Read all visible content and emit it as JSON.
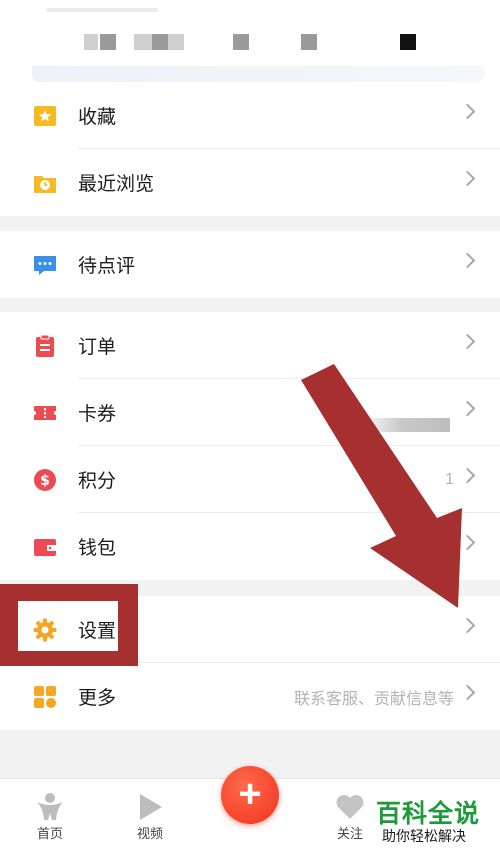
{
  "menu": {
    "favorites": {
      "label": "收藏",
      "icon": "star-folder-icon"
    },
    "recent": {
      "label": "最近浏览",
      "icon": "clock-folder-icon"
    },
    "pending_review": {
      "label": "待点评",
      "icon": "chat-bubble-icon"
    },
    "orders": {
      "label": "订单",
      "icon": "clipboard-icon"
    },
    "coupons": {
      "label": "卡券",
      "icon": "ticket-icon"
    },
    "points": {
      "label": "积分",
      "value": "1",
      "icon": "dollar-icon"
    },
    "wallet": {
      "label": "钱包",
      "icon": "wallet-icon"
    },
    "settings": {
      "label": "设置",
      "icon": "gear-icon"
    },
    "more": {
      "label": "更多",
      "hint": "联系客服、贡献信息等",
      "icon": "grid-icon"
    }
  },
  "bottom_nav": {
    "home": "首页",
    "video": "视频",
    "publish": "+",
    "follow": "关注"
  },
  "watermark": {
    "title": "百科全说",
    "subtitle": "助你轻松解决"
  },
  "colors": {
    "accent_red": "#f0321e",
    "annotation": "#a63030",
    "watermark_green": "#1f9a3a"
  }
}
